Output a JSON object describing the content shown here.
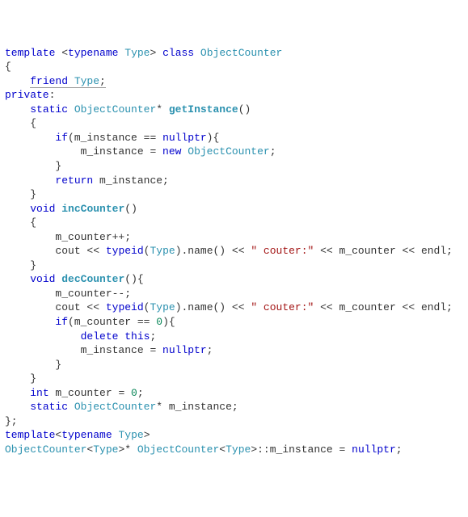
{
  "code": {
    "l1_template": "template ",
    "l1_angle1": "<",
    "l1_typename": "typename",
    "l1_space": " ",
    "l1_Type": "Type",
    "l1_angle2": "> ",
    "l1_class": "class",
    "l1_sp2": " ",
    "l1_ObjectCounter": "ObjectCounter",
    "l2": "{",
    "l3_ind": "    ",
    "l3_friend": "friend ",
    "l3_Type": "Type",
    "l3_semi": ";",
    "l4_private": "private",
    "l4_colon": ":",
    "l5_ind": "    ",
    "l5_static": "static",
    "l5_sp": " ",
    "l5_Type": "ObjectCounter",
    "l5_star": "* ",
    "l5_func": "getInstance",
    "l5_paren": "()",
    "l6_ind": "    ",
    "l6_brace": "{",
    "l7_ind": "        ",
    "l7_if": "if",
    "l7_open": "(m_instance == ",
    "l7_null": "nullptr",
    "l7_close": "){",
    "l8_ind": "            ",
    "l8_assign": "m_instance = ",
    "l8_new": "new",
    "l8_sp": " ",
    "l8_Type": "ObjectCounter",
    "l8_semi": ";",
    "l9_ind": "        ",
    "l9_brace": "}",
    "l10_ind": "        ",
    "l10_return": "return",
    "l10_rest": " m_instance;",
    "l11_ind": "    ",
    "l11_brace": "}",
    "l12_ind": "    ",
    "l12_void": "void",
    "l12_sp": " ",
    "l12_func": "incCounter",
    "l12_paren": "()",
    "l13_ind": "    ",
    "l13_brace": "{",
    "l14_ind": "        ",
    "l14_code": "m_counter++;",
    "l15_ind": "        ",
    "l15_a": "cout << ",
    "l15_typeid": "typeid",
    "l15_b": "(",
    "l15_Type": "Type",
    "l15_c": ").name() << ",
    "l15_str": "\" couter:\"",
    "l15_d": " << m_counter << endl;",
    "l16_ind": "    ",
    "l16_brace": "}",
    "l17_ind": "    ",
    "l17_void": "void",
    "l17_sp": " ",
    "l17_func": "decCounter",
    "l17_paren": "(){",
    "l18_ind": "        ",
    "l18_code": "m_counter--;",
    "l19_ind": "        ",
    "l19_a": "cout << ",
    "l19_typeid": "typeid",
    "l19_b": "(",
    "l19_Type": "Type",
    "l19_c": ").name() << ",
    "l19_str": "\" couter:\"",
    "l19_d": " << m_counter << endl;",
    "l20_ind": "        ",
    "l20_if": "if",
    "l20_open": "(m_counter == ",
    "l20_zero": "0",
    "l20_close": "){",
    "l21_ind": "            ",
    "l21_delete": "delete",
    "l21_sp": " ",
    "l21_this": "this",
    "l21_semi": ";",
    "l22_ind": "            ",
    "l22_a": "m_instance = ",
    "l22_null": "nullptr",
    "l22_semi": ";",
    "l23_ind": "        ",
    "l23_brace": "}",
    "l24_ind": "    ",
    "l24_brace": "}",
    "l25_ind": "    ",
    "l25_int": "int",
    "l25_sp": " m_counter = ",
    "l25_zero": "0",
    "l25_semi": ";",
    "l26_ind": "    ",
    "l26_static": "static",
    "l26_sp": " ",
    "l26_Type": "ObjectCounter",
    "l26_rest": "* m_instance;",
    "l27": "};",
    "l28": "",
    "l29_template": "template",
    "l29_angle1": "<",
    "l29_typename": "typename",
    "l29_sp": " ",
    "l29_Type": "Type",
    "l29_angle2": ">",
    "l30_a": "ObjectCounter",
    "l30_b": "<",
    "l30_Type1": "Type",
    "l30_c": ">* ",
    "l30_d": "ObjectCounter",
    "l30_e": "<",
    "l30_Type2": "Type",
    "l30_f": ">::m_instance = ",
    "l30_null": "nullptr",
    "l30_semi": ";"
  }
}
